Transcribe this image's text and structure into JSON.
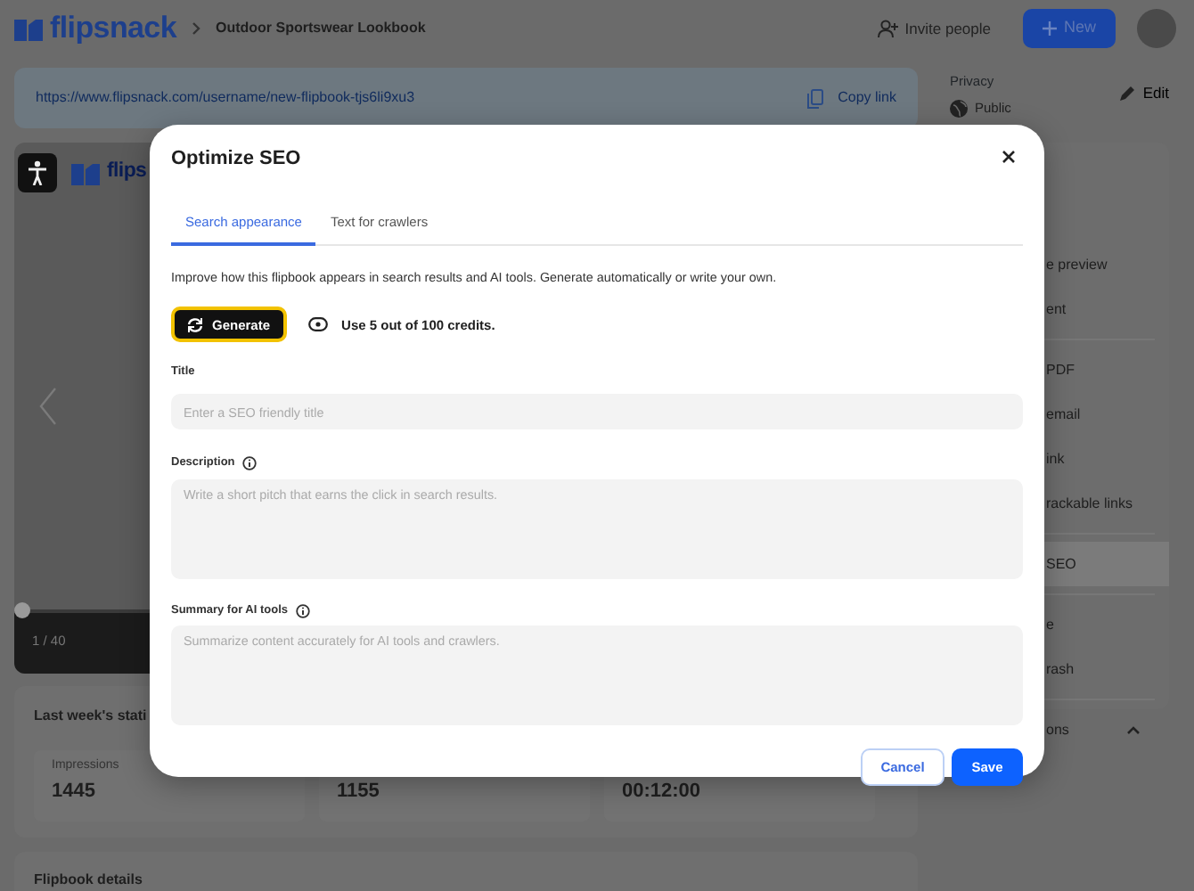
{
  "header": {
    "logo": "flipsnack",
    "breadcrumb": "Outdoor Sportswear Lookbook",
    "invite": "Invite people",
    "new_button": "New"
  },
  "link_bar": {
    "url": "https://www.flipsnack.com/username/new-flipbook-tjs6li9xu3",
    "copy_link": "Copy link"
  },
  "privacy": {
    "label": "Privacy",
    "value": "Public",
    "edit": "Edit"
  },
  "viewer": {
    "logo": "flips",
    "page_indicator": "1 / 40",
    "level": 0
  },
  "stats": {
    "title": "Last week's stati",
    "metrics": [
      {
        "label": "Impressions",
        "value": "1445"
      },
      {
        "value": "1155"
      },
      {
        "value": "00:12:00"
      }
    ]
  },
  "details": {
    "title": "Flipbook details"
  },
  "sidebar": {
    "groups": [
      {
        "items": [
          {
            "label": "e preview",
            "selected": false
          },
          {
            "label": "ent",
            "selected": false
          }
        ]
      },
      {
        "items": [
          {
            "label": "PDF",
            "selected": false
          },
          {
            "label": "email",
            "selected": false
          },
          {
            "label": "ink",
            "selected": false
          },
          {
            "label": "rackable links",
            "selected": false
          }
        ]
      },
      {
        "items": [
          {
            "label": "SEO",
            "selected": true
          }
        ]
      },
      {
        "items": [
          {
            "label": "e",
            "selected": false
          },
          {
            "label": "rash",
            "selected": false
          }
        ]
      }
    ],
    "footer": {
      "label": "ons",
      "expanded": true
    }
  },
  "modal": {
    "title": "Optimize SEO",
    "tabs": [
      {
        "label": "Search appearance",
        "selected": true
      },
      {
        "label": "Text for crawlers",
        "selected": false
      }
    ],
    "intro": "Improve how this flipbook appears in search results and AI tools. Generate automatically or write your own.",
    "generate_button": {
      "label": "Generate",
      "focused": true
    },
    "credits": "Use 5 out of 100 credits.",
    "fields": [
      {
        "kind": "input",
        "label": "Title",
        "info": false,
        "placeholder": "Enter a SEO friendly title"
      },
      {
        "kind": "textarea",
        "label": "Description",
        "info": true,
        "placeholder": "Write a short pitch that earns the click in search results."
      },
      {
        "kind": "textarea",
        "label": "Summary for AI tools",
        "info": true,
        "placeholder": "Summarize content accurately for AI tools and crawlers."
      }
    ],
    "buttons": [
      {
        "kind": "secondary",
        "label": "Cancel"
      },
      {
        "kind": "primary",
        "label": "Save"
      }
    ]
  }
}
